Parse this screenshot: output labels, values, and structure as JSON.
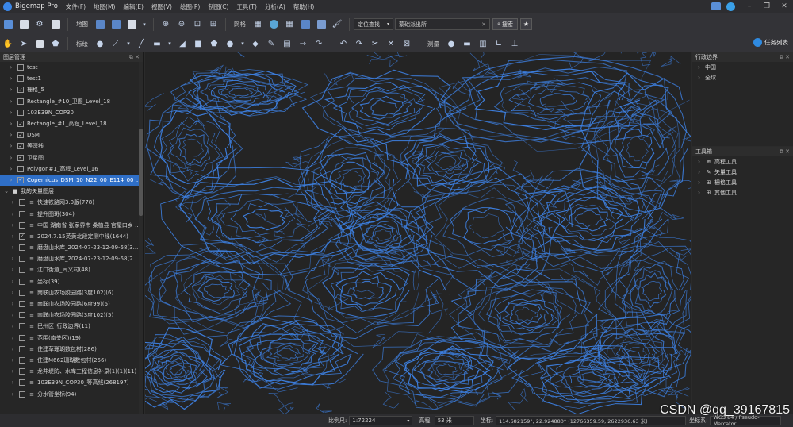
{
  "app": {
    "title": "Bigemap Pro"
  },
  "menu": [
    "文件(F)",
    "地图(M)",
    "编辑(E)",
    "视图(V)",
    "绘图(P)",
    "制图(C)",
    "工具(T)",
    "分析(A)",
    "帮助(H)"
  ],
  "toolbar1": {
    "map_label": "地图",
    "grid_label": "网格",
    "locate_select": "定位查找",
    "search_value": "蒙础派出所",
    "search_button": "搜索"
  },
  "toolbar2": {
    "mark_label": "标绘",
    "measure_label": "测量",
    "task_list": "任务列表"
  },
  "layer_panel": {
    "title": "图层管理",
    "items": [
      {
        "label": "test",
        "checked": false,
        "arrow": "›",
        "indent": 1
      },
      {
        "label": "test1",
        "checked": false,
        "arrow": "›",
        "indent": 1
      },
      {
        "label": "栅格_5",
        "checked": true,
        "arrow": "›",
        "indent": 1
      },
      {
        "label": "Rectangle_#10_卫图_Level_18",
        "checked": false,
        "arrow": "›",
        "indent": 1
      },
      {
        "label": "103E39N_COP30",
        "checked": false,
        "arrow": "›",
        "indent": 1
      },
      {
        "label": "Rectangle_#1_高程_Level_18",
        "checked": true,
        "arrow": "›",
        "indent": 1
      },
      {
        "label": "DSM",
        "checked": true,
        "arrow": "›",
        "indent": 1
      },
      {
        "label": "等深线",
        "checked": true,
        "arrow": "›",
        "indent": 1
      },
      {
        "label": "卫星图",
        "checked": true,
        "arrow": "›",
        "indent": 1
      },
      {
        "label": "Polygon#1_高程_Level_16",
        "checked": false,
        "arrow": "›",
        "indent": 1
      },
      {
        "label": "Copernicus_DSM_10_N22_00_E114_00_...",
        "checked": true,
        "arrow": "›",
        "indent": 1,
        "selected": true
      },
      {
        "label": "我的矢量图层",
        "checked": null,
        "arrow": "⌄",
        "indent": 0,
        "group": true
      },
      {
        "label": "快速铁路网3.0版(778)",
        "checked": false,
        "arrow": "›",
        "indent": 2
      },
      {
        "label": "提升图斑(304)",
        "checked": false,
        "arrow": "›",
        "indent": 2
      },
      {
        "label": "中国 湖南省 张家界市 桑植县 官屋口乡 ...",
        "checked": false,
        "arrow": "›",
        "indent": 2
      },
      {
        "label": "2024.7.15英黄北段定测中线(1644)",
        "checked": true,
        "arrow": "›",
        "indent": 2
      },
      {
        "label": "磨盘山水库_2024-07-23-12-09-58(3...",
        "checked": false,
        "arrow": "›",
        "indent": 2
      },
      {
        "label": "磨盘山水库_2024-07-23-12-09-58(2...",
        "checked": false,
        "arrow": "›",
        "indent": 2
      },
      {
        "label": "江口街道_同义村(48)",
        "checked": false,
        "arrow": "›",
        "indent": 2
      },
      {
        "label": "坐标(39)",
        "checked": false,
        "arrow": "›",
        "indent": 2
      },
      {
        "label": "南联山农场胶园路(3度102)(6)",
        "checked": false,
        "arrow": "›",
        "indent": 2
      },
      {
        "label": "南联山农场胶园路(6度99)(6)",
        "checked": false,
        "arrow": "›",
        "indent": 2
      },
      {
        "label": "南联山农场胶园路(3度102)(5)",
        "checked": false,
        "arrow": "›",
        "indent": 2
      },
      {
        "label": "巴州区_行政边界(11)",
        "checked": false,
        "arrow": "›",
        "indent": 2
      },
      {
        "label": "范围(南关区)(19)",
        "checked": false,
        "arrow": "›",
        "indent": 2
      },
      {
        "label": "住建草珊瑚数包村(286)",
        "checked": false,
        "arrow": "›",
        "indent": 2
      },
      {
        "label": "住建M662珊瑚数包村(256)",
        "checked": false,
        "arrow": "›",
        "indent": 2
      },
      {
        "label": "龙井堤防、水库工程信息补录(1)(1)(11)",
        "checked": false,
        "arrow": "›",
        "indent": 2
      },
      {
        "label": "103E39N_COP30_等高线(268197)",
        "checked": false,
        "arrow": "›",
        "indent": 2
      },
      {
        "label": "分水管坐标(94)",
        "checked": false,
        "arrow": "›",
        "indent": 2
      }
    ]
  },
  "admin_panel": {
    "title": "行政边界",
    "items": [
      "中国",
      "全球"
    ]
  },
  "toolbox_panel": {
    "title": "工具箱",
    "items": [
      {
        "label": "高程工具",
        "icon": "≋"
      },
      {
        "label": "矢量工具",
        "icon": "✎"
      },
      {
        "label": "栅格工具",
        "icon": "⊞"
      },
      {
        "label": "其他工具",
        "icon": "⊞"
      }
    ]
  },
  "status": {
    "scale_label": "比例尺:",
    "scale_value": "1:72224",
    "elevation_label": "高程:",
    "elevation_value": "53 米",
    "coord_label": "坐标:",
    "coord_value": "114.682159°, 22.924880°  (12766359.59, 2622936.63 米)",
    "crs_label": "坐标系:",
    "crs_value": "WGS 84 / Pseudo-Mercator"
  },
  "watermark": "CSDN @qq_39167815",
  "colors": {
    "accent": "#2f6fc7",
    "contour": "#3d7fe0",
    "background": "#2b2b2b"
  }
}
